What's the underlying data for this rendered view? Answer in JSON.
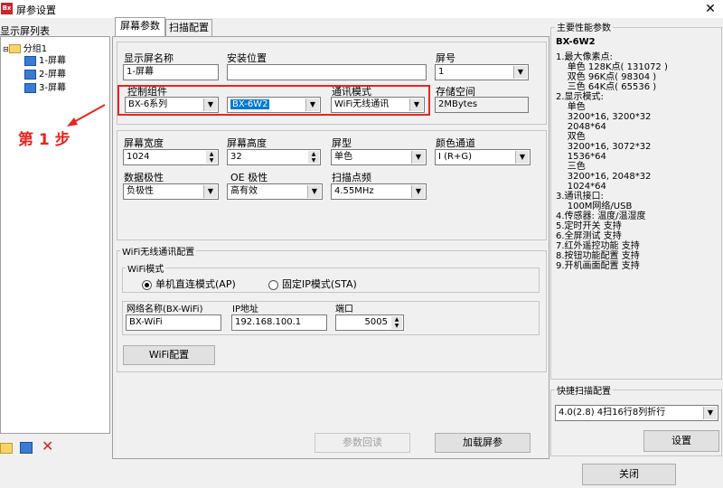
{
  "window": {
    "title": "屏参设置",
    "app_icon_text": "Bx",
    "close_glyph": "✕"
  },
  "left_panel": {
    "title": "显示屏列表",
    "tree": [
      {
        "label": "分组1",
        "type": "group"
      },
      {
        "label": "1-屏幕",
        "type": "screen"
      },
      {
        "label": "2-屏幕",
        "type": "screen"
      },
      {
        "label": "3-屏幕",
        "type": "screen"
      }
    ],
    "toolbar_icons": [
      "folder-icon",
      "monitor-icon",
      "delete-icon"
    ]
  },
  "annotation": {
    "step_text": "第 1 步",
    "arrow_color": "#e8261f"
  },
  "tabs": [
    {
      "label": "屏幕参数",
      "active": true
    },
    {
      "label": "扫描配置",
      "active": false
    }
  ],
  "basic": {
    "name_label": "显示屏名称",
    "name_value": "1-屏幕",
    "location_label": "安装位置",
    "location_value": "",
    "number_label": "屏号",
    "number_value": "1",
    "controller_label": "控制组件",
    "controller_series": "BX-6系列",
    "controller_model": "BX-6W2",
    "comm_label": "通讯模式",
    "comm_value": "WiFi无线通讯",
    "storage_label": "存储空间",
    "storage_value": "2MBytes"
  },
  "screen": {
    "width_label": "屏幕宽度",
    "width_value": "1024",
    "height_label": "屏幕高度",
    "height_value": "32",
    "type_label": "屏型",
    "type_value": "单色",
    "color_label": "颜色通道",
    "color_value": "I (R+G)",
    "polarity_label": "数据极性",
    "polarity_value": "负极性",
    "oe_label": "OE 极性",
    "oe_value": "高有效",
    "freq_label": "扫描点频",
    "freq_value": "4.55MHz"
  },
  "wifi": {
    "group_title": "WiFi无线通讯配置",
    "mode_title": "WiFi模式",
    "mode_ap": "单机直连模式(AP)",
    "mode_sta": "固定IP模式(STA)",
    "ssid_label": "网络名称(BX-WiFi)",
    "ssid_value": "BX-WiFi",
    "ip_label": "IP地址",
    "ip_value": "192.168.100.1",
    "port_label": "端口",
    "port_value": "5005",
    "config_button": "WiFi配置"
  },
  "buttons": {
    "readback": "参数回读",
    "load": "加载屏参",
    "setup": "设置",
    "close": "关闭"
  },
  "performance": {
    "title": "主要性能参数",
    "model": "BX-6W2",
    "lines": [
      "1.最大像素点:",
      "    单色 128K点( 131072 )",
      "    双色 96K点( 98304 )",
      "    三色 64K点( 65536 )",
      "2.显示模式:",
      "    单色",
      "    3200*16, 3200*32",
      "    2048*64",
      "    双色",
      "    3200*16, 3072*32",
      "    1536*64",
      "    三色",
      "    3200*16, 2048*32",
      "    1024*64",
      "3.通讯接口:",
      "    100M网络/USB",
      "4.传感器: 温度/温湿度",
      "5.定时开关 支持",
      "6.全屏测试 支持",
      "7.红外遥控功能 支持",
      "8.按钮功能配置 支持",
      "9.开机画面配置 支持"
    ]
  },
  "quick_scan": {
    "title": "快捷扫描配置",
    "value": "4.0(2.8) 4扫16行8列折行"
  }
}
